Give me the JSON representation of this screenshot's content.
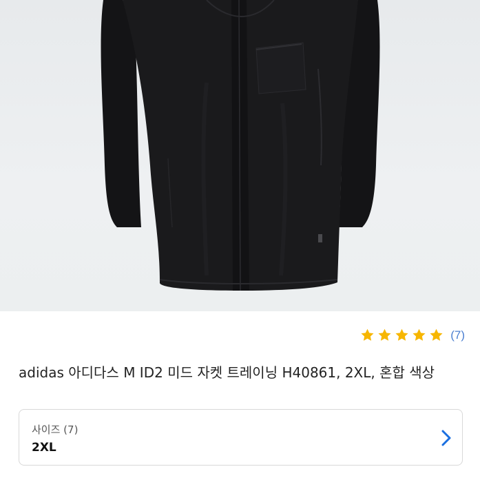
{
  "product": {
    "title": "adidas 아디다스 M ID2 미드 자켓 트레이닝 H40861, 2XL, 혼합 색상",
    "rating_stars": 5,
    "review_count": "(7)",
    "star_color": "#f7b600",
    "image_icon": "black-long-jacket-image"
  },
  "option": {
    "label": "사이즈 (7)",
    "value": "2XL",
    "chevron_icon": "chevron-right-icon",
    "chevron_color": "#1a6fe0"
  }
}
